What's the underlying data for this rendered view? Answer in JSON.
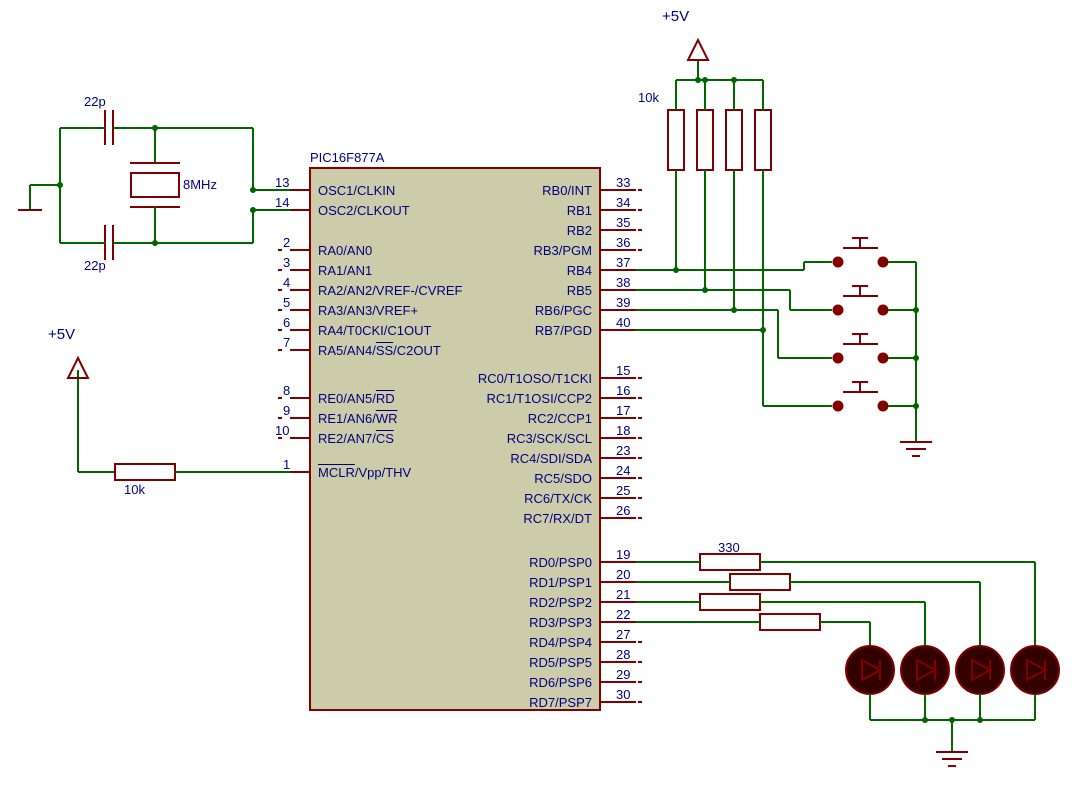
{
  "power": {
    "vcc1": "+5V",
    "vcc2": "+5V"
  },
  "crystal": {
    "freq": "8MHz",
    "cap1": "22p",
    "cap2": "22p"
  },
  "resistors": {
    "mclr": "10k",
    "pullup": "10k",
    "led": "330"
  },
  "chip": {
    "name": "PIC16F877A",
    "left": [
      {
        "pin": "13",
        "label": "OSC1/CLKIN"
      },
      {
        "pin": "14",
        "label": "OSC2/CLKOUT"
      },
      {
        "pin": "",
        "label": ""
      },
      {
        "pin": "2",
        "label": "RA0/AN0"
      },
      {
        "pin": "3",
        "label": "RA1/AN1"
      },
      {
        "pin": "4",
        "label": "RA2/AN2/VREF-/CVREF"
      },
      {
        "pin": "5",
        "label": "RA3/AN3/VREF+"
      },
      {
        "pin": "6",
        "label": "RA4/T0CKI/C1OUT"
      },
      {
        "pin": "7",
        "label": "RA5/AN4/~SS~/C2OUT"
      },
      {
        "pin": "",
        "label": ""
      },
      {
        "pin": "8",
        "label": "RE0/AN5/~RD~"
      },
      {
        "pin": "9",
        "label": "RE1/AN6/~WR~"
      },
      {
        "pin": "10",
        "label": "RE2/AN7/~CS~"
      },
      {
        "pin": "",
        "label": ""
      },
      {
        "pin": "1",
        "label": "~MCLR~/Vpp/THV"
      }
    ],
    "right": [
      {
        "pin": "33",
        "label": "RB0/INT"
      },
      {
        "pin": "34",
        "label": "RB1"
      },
      {
        "pin": "35",
        "label": "RB2"
      },
      {
        "pin": "36",
        "label": "RB3/PGM"
      },
      {
        "pin": "37",
        "label": "RB4"
      },
      {
        "pin": "38",
        "label": "RB5"
      },
      {
        "pin": "39",
        "label": "RB6/PGC"
      },
      {
        "pin": "40",
        "label": "RB7/PGD"
      },
      {
        "pin": "",
        "label": ""
      },
      {
        "pin": "15",
        "label": "RC0/T1OSO/T1CKI"
      },
      {
        "pin": "16",
        "label": "RC1/T1OSI/CCP2"
      },
      {
        "pin": "17",
        "label": "RC2/CCP1"
      },
      {
        "pin": "18",
        "label": "RC3/SCK/SCL"
      },
      {
        "pin": "23",
        "label": "RC4/SDI/SDA"
      },
      {
        "pin": "24",
        "label": "RC5/SDO"
      },
      {
        "pin": "25",
        "label": "RC6/TX/CK"
      },
      {
        "pin": "26",
        "label": "RC7/RX/DT"
      },
      {
        "pin": "",
        "label": ""
      },
      {
        "pin": "19",
        "label": "RD0/PSP0"
      },
      {
        "pin": "20",
        "label": "RD1/PSP1"
      },
      {
        "pin": "21",
        "label": "RD2/PSP2"
      },
      {
        "pin": "22",
        "label": "RD3/PSP3"
      },
      {
        "pin": "27",
        "label": "RD4/PSP4"
      },
      {
        "pin": "28",
        "label": "RD5/PSP5"
      },
      {
        "pin": "29",
        "label": "RD6/PSP6"
      },
      {
        "pin": "30",
        "label": "RD7/PSP7"
      }
    ]
  }
}
